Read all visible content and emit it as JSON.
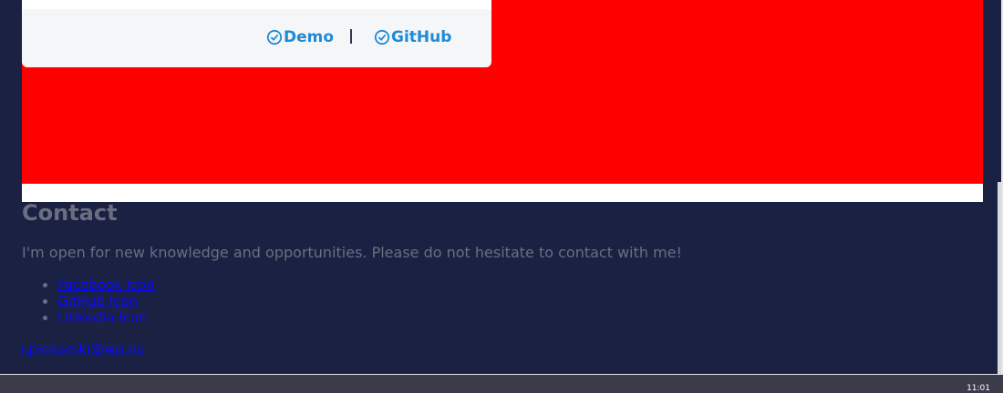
{
  "project_card": {
    "demo_label": "Demo",
    "github_label": "GitHub"
  },
  "contact": {
    "title": "Contact",
    "text": "I'm open for new knowledge and opportunities. Please do not hesitate to contact with me!",
    "links": [
      {
        "label": "Facebook Icon"
      },
      {
        "label": "GitHub Icon"
      },
      {
        "label": "Linkedin Icon"
      }
    ],
    "email": "r.piekarski@wp.eu"
  },
  "taskbar": {
    "clock": "11:01"
  },
  "colors": {
    "background": "#1a2142",
    "highlight": "#ff0000",
    "link": "#1f8ad6"
  }
}
